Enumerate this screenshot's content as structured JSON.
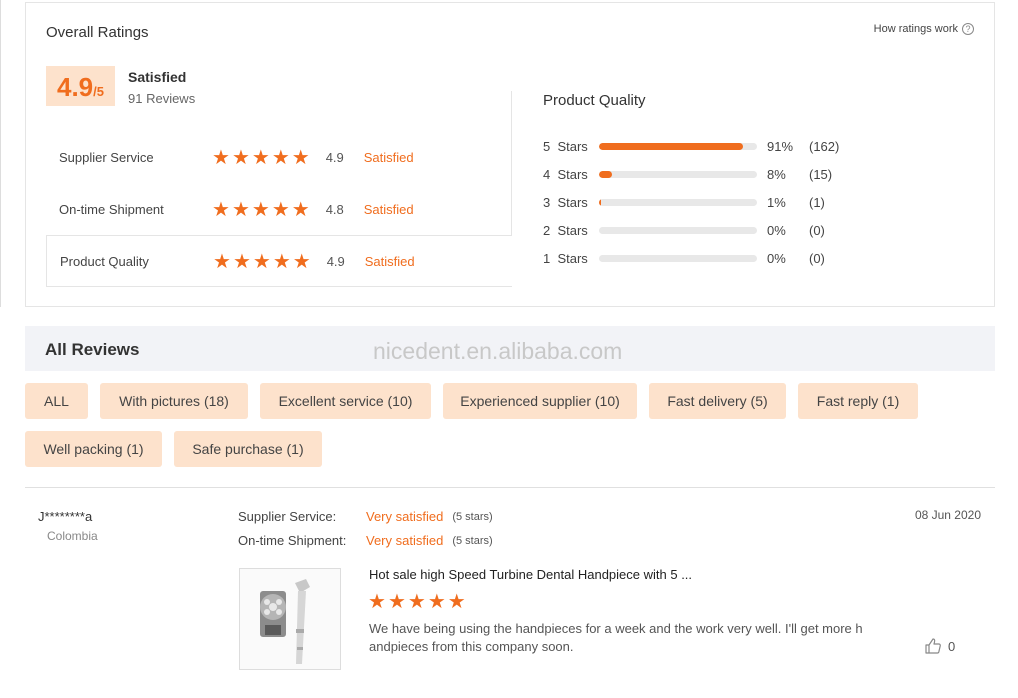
{
  "overall": {
    "title": "Overall Ratings",
    "how_link": "How ratings work",
    "score": "4.9",
    "score_max": "/5",
    "level": "Satisfied",
    "reviews_count": "91 Reviews",
    "dimensions": [
      {
        "name": "Supplier Service",
        "stars": 5,
        "score": "4.9",
        "level": "Satisfied"
      },
      {
        "name": "On-time Shipment",
        "stars": 5,
        "score": "4.8",
        "level": "Satisfied"
      },
      {
        "name": "Product Quality",
        "stars": 5,
        "score": "4.9",
        "level": "Satisfied"
      }
    ]
  },
  "distribution": {
    "title": "Product Quality",
    "rows": [
      {
        "label": "5  Stars",
        "fraction": 0.91,
        "pct": "91%",
        "count": "(162)"
      },
      {
        "label": "4  Stars",
        "fraction": 0.08,
        "pct": "8%",
        "count": "(15)"
      },
      {
        "label": "3  Stars",
        "fraction": 0.01,
        "pct": "1%",
        "count": "(1)"
      },
      {
        "label": "2  Stars",
        "fraction": 0.0,
        "pct": "0%",
        "count": "(0)"
      },
      {
        "label": "1  Stars",
        "fraction": 0.0,
        "pct": "0%",
        "count": "(0)"
      }
    ]
  },
  "reviews": {
    "title": "All Reviews",
    "watermark": "nicedent.en.alibaba.com",
    "filters": [
      "ALL",
      "With pictures (18)",
      "Excellent service (10)",
      "Experienced supplier (10)",
      "Fast delivery (5)",
      "Fast reply (1)",
      "Well packing (1)",
      "Safe purchase (1)"
    ]
  },
  "review": {
    "name": "J********a",
    "country": "Colombia",
    "date": "08 Jun 2020",
    "supplier_service_label": "Supplier Service:",
    "supplier_service_value": "Very satisfied",
    "supplier_service_note": "(5 stars)",
    "shipment_label": "On-time Shipment:",
    "shipment_value": "Very satisfied",
    "shipment_note": "(5 stars)",
    "product_title": "Hot sale high Speed Turbine Dental Handpiece with 5 ...",
    "product_stars": 5,
    "text": "We have being using the handpieces for a week and the work very well. I'll get more handpieces from this company soon.",
    "likes": "0"
  },
  "colors": {
    "accent": "#f06d1e",
    "tag_bg": "#fde2cc"
  }
}
